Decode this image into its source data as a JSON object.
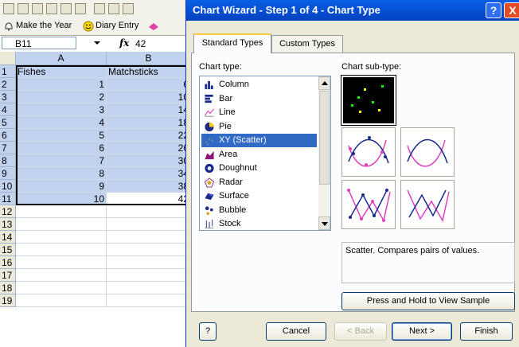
{
  "excel": {
    "toolbar2": {
      "item1": "Make the Year",
      "item2": "Diary Entry"
    },
    "namebox": "B11",
    "fx_label": "fx",
    "formula_value": "42",
    "columns": [
      "A",
      "B"
    ],
    "rows": [
      "1",
      "2",
      "3",
      "4",
      "5",
      "6",
      "7",
      "8",
      "9",
      "10",
      "11",
      "12",
      "13",
      "14",
      "15",
      "16",
      "17",
      "18",
      "19"
    ],
    "cells": [
      [
        "Fishes",
        "Matchsticks"
      ],
      [
        "1",
        "6"
      ],
      [
        "2",
        "10"
      ],
      [
        "3",
        "14"
      ],
      [
        "4",
        "18"
      ],
      [
        "5",
        "22"
      ],
      [
        "6",
        "26"
      ],
      [
        "7",
        "30"
      ],
      [
        "8",
        "34"
      ],
      [
        "9",
        "38"
      ],
      [
        "10",
        "42"
      ]
    ]
  },
  "dialog": {
    "title": "Chart Wizard - Step 1 of 4 - Chart Type",
    "help_btn": "?",
    "close_btn": "X",
    "tabs": [
      "Standard Types",
      "Custom Types"
    ],
    "chart_type_label": "Chart type:",
    "chart_subtype_label": "Chart sub-type:",
    "chart_types": [
      "Column",
      "Bar",
      "Line",
      "Pie",
      "XY (Scatter)",
      "Area",
      "Doughnut",
      "Radar",
      "Surface",
      "Bubble",
      "Stock"
    ],
    "selected_type": "XY (Scatter)",
    "description": "Scatter. Compares pairs of values.",
    "view_sample": "Press and Hold to View Sample",
    "buttons": {
      "help": "?",
      "cancel": "Cancel",
      "back": "< Back",
      "next": "Next >",
      "finish": "Finish"
    }
  }
}
